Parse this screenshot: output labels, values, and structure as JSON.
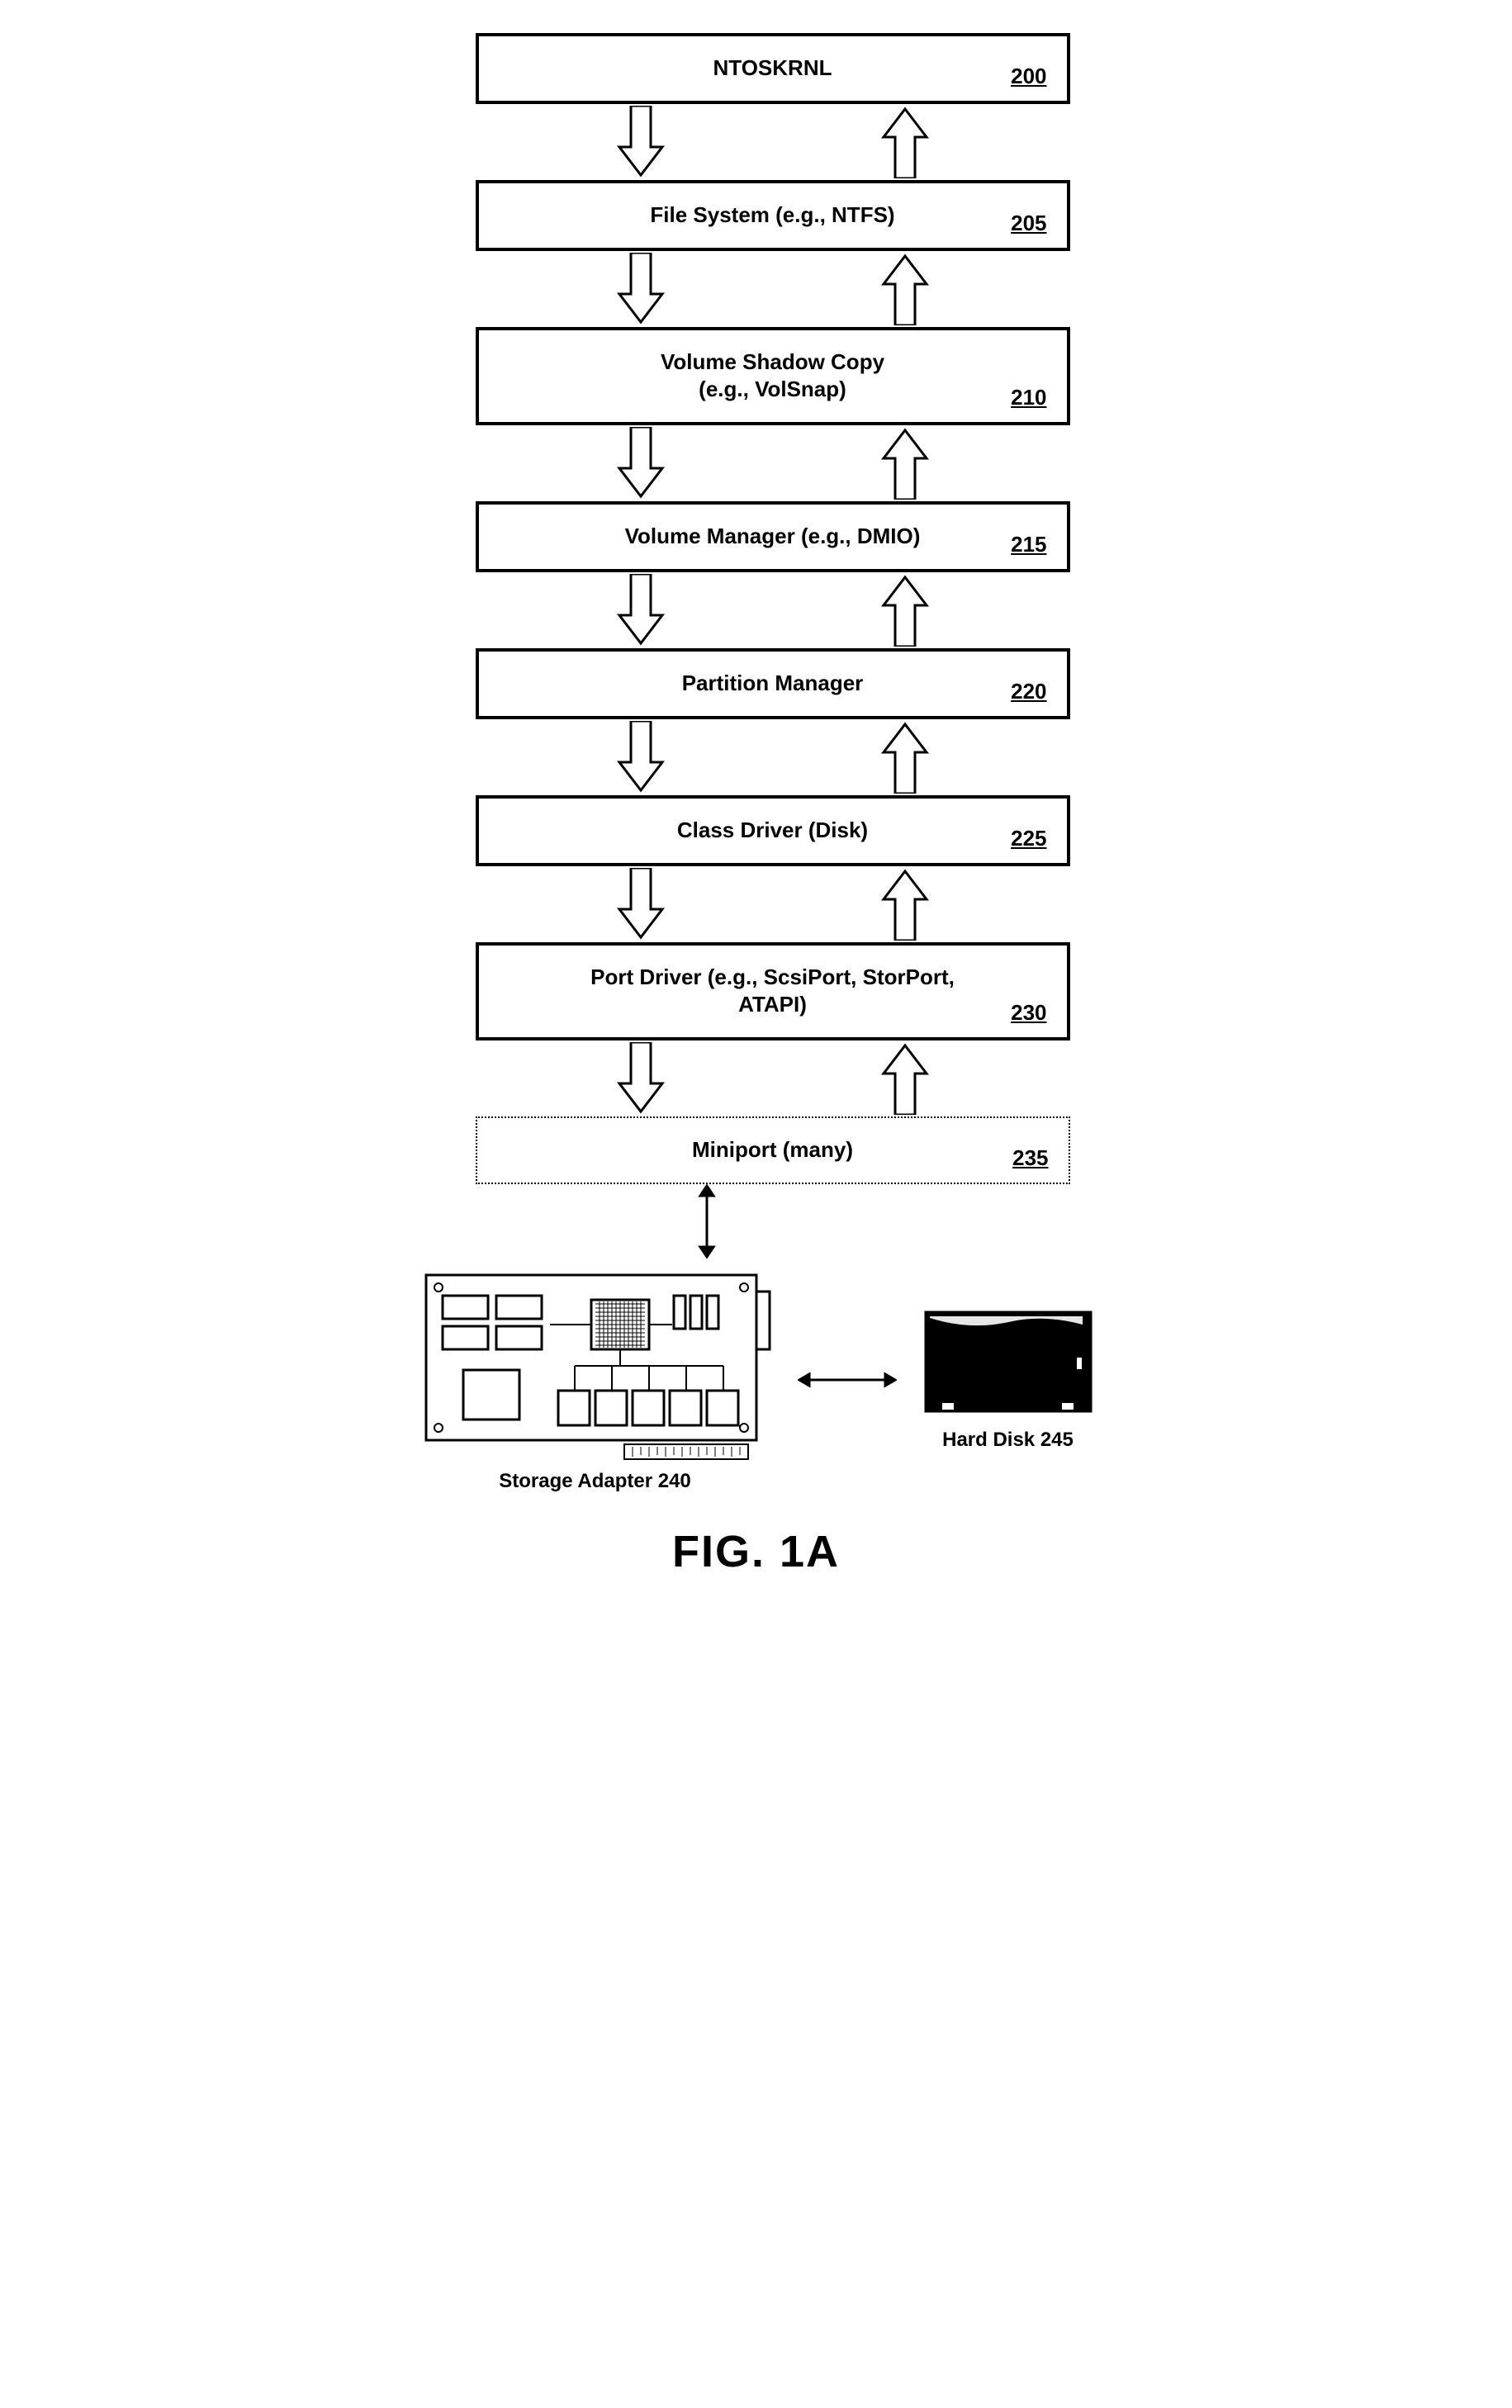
{
  "blocks": [
    {
      "label": "NTOSKRNL",
      "ref": "200",
      "dotted": false
    },
    {
      "label": "File System (e.g., NTFS)",
      "ref": "205",
      "dotted": false
    },
    {
      "label": "Volume Shadow Copy\n(e.g., VolSnap)",
      "ref": "210",
      "dotted": false
    },
    {
      "label": "Volume Manager (e.g., DMIO)",
      "ref": "215",
      "dotted": false
    },
    {
      "label": "Partition Manager",
      "ref": "220",
      "dotted": false
    },
    {
      "label": "Class Driver (Disk)",
      "ref": "225",
      "dotted": false
    },
    {
      "label": "Port Driver (e.g., ScsiPort, StorPort,\nATAPI)",
      "ref": "230",
      "dotted": false
    },
    {
      "label": "Miniport (many)",
      "ref": "235",
      "dotted": true
    }
  ],
  "hardware": {
    "adapter_label": "Storage Adapter 240",
    "disk_label": "Hard Disk 245"
  },
  "figure_label": "FIG. 1A"
}
